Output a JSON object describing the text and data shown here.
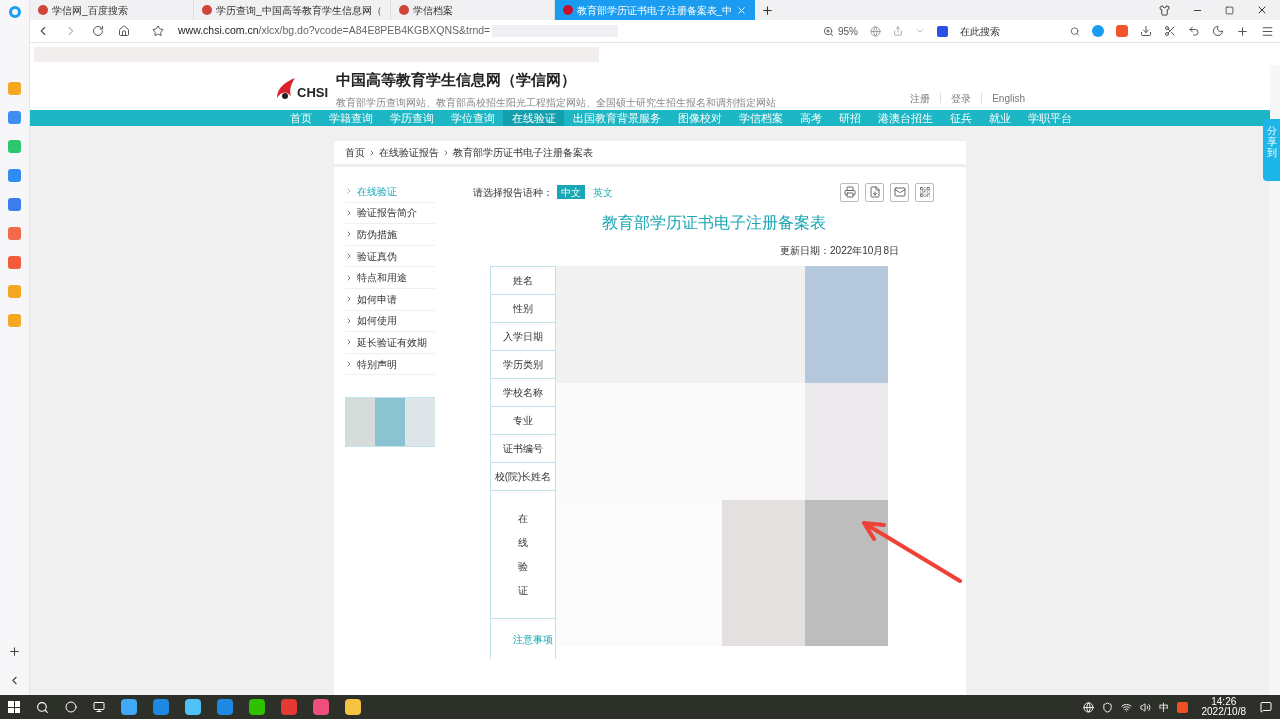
{
  "browser_tabs": [
    {
      "title": "学信网_百度搜索",
      "selected": false
    },
    {
      "title": "学历查询_中国高等教育学生信息网（",
      "selected": false
    },
    {
      "title": "学信档案",
      "selected": false
    },
    {
      "title": "教育部学历证书电子注册备案表_中",
      "selected": true
    }
  ],
  "address_bar": {
    "host": "www.chsi.com.cn",
    "path": "/xlcx/bg.do?vcode=A84E8PEB4KGBXQNS&trnd=",
    "zoom": "95%"
  },
  "search": {
    "placeholder": "在此搜索"
  },
  "site": {
    "logo_text": "CHSI",
    "title": "中国高等教育学生信息网（学信网）",
    "subtitle": "教育部学历查询网站、教育部高校招生阳光工程指定网站、全国硕士研究生招生报名和调剂指定网站",
    "links": [
      "注册",
      "登录",
      "English"
    ]
  },
  "nav": [
    {
      "label": "首页",
      "selected": false
    },
    {
      "label": "学籍查询",
      "selected": false
    },
    {
      "label": "学历查询",
      "selected": false
    },
    {
      "label": "学位查询",
      "selected": false
    },
    {
      "label": "在线验证",
      "selected": true
    },
    {
      "label": "出国教育背景服务",
      "selected": false
    },
    {
      "label": "图像校对",
      "selected": false
    },
    {
      "label": "学信档案",
      "selected": false
    },
    {
      "label": "高考",
      "selected": false
    },
    {
      "label": "研招",
      "selected": false
    },
    {
      "label": "港澳台招生",
      "selected": false
    },
    {
      "label": "征兵",
      "selected": false
    },
    {
      "label": "就业",
      "selected": false
    },
    {
      "label": "学职平台",
      "selected": false
    }
  ],
  "breadcrumb": [
    "首页",
    "在线验证报告",
    "教育部学历证书电子注册备案表"
  ],
  "side_menu": [
    {
      "label": "在线验证",
      "selected": true
    },
    {
      "label": "验证报告简介",
      "selected": false
    },
    {
      "label": "防伪措施",
      "selected": false
    },
    {
      "label": "验证真伪",
      "selected": false
    },
    {
      "label": "特点和用途",
      "selected": false
    },
    {
      "label": "如何申请",
      "selected": false
    },
    {
      "label": "如何使用",
      "selected": false
    },
    {
      "label": "延长验证有效期",
      "selected": false
    },
    {
      "label": "特别声明",
      "selected": false
    }
  ],
  "language": {
    "label": "请选择报告语种：",
    "options": [
      {
        "label": "中文",
        "selected": true
      },
      {
        "label": "英文",
        "selected": false
      }
    ]
  },
  "report": {
    "title": "教育部学历证书电子注册备案表",
    "updated": "更新日期：2022年10月8日",
    "fields": [
      "姓名",
      "性别",
      "入学日期",
      "学历类别",
      "学校名称",
      "专业",
      "证书编号",
      "校(院)长姓名"
    ],
    "verify_label": "在线验证",
    "note_link": "注意事项"
  },
  "share_tab": "分享到",
  "taskbar": {
    "ime": "中",
    "time": "14:26",
    "date": "2022/10/8"
  }
}
